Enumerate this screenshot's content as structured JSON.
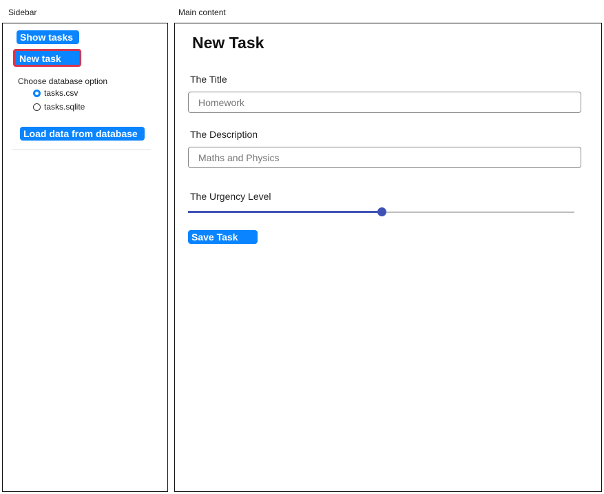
{
  "regions": {
    "sidebar_label": "Sidebar",
    "main_label": "Main content"
  },
  "sidebar": {
    "show_tasks_label": "Show tasks",
    "new_task_label": "New task",
    "db_heading": "Choose database option",
    "db_options": [
      {
        "label": "tasks.csv",
        "selected": true
      },
      {
        "label": "tasks.sqlite",
        "selected": false
      }
    ],
    "load_data_label": "Load data from database"
  },
  "main": {
    "title": "New Task",
    "title_field": {
      "label": "The Title",
      "placeholder": "Homework"
    },
    "description_field": {
      "label": "The Description",
      "placeholder": "Maths and Physics"
    },
    "urgency": {
      "label": "The Urgency Level",
      "value_fraction": 0.5
    },
    "save_label": "Save Task"
  },
  "colors": {
    "button_bg": "#0a84ff",
    "active_outline": "#d9354f",
    "slider_accent": "#3f51b5"
  }
}
